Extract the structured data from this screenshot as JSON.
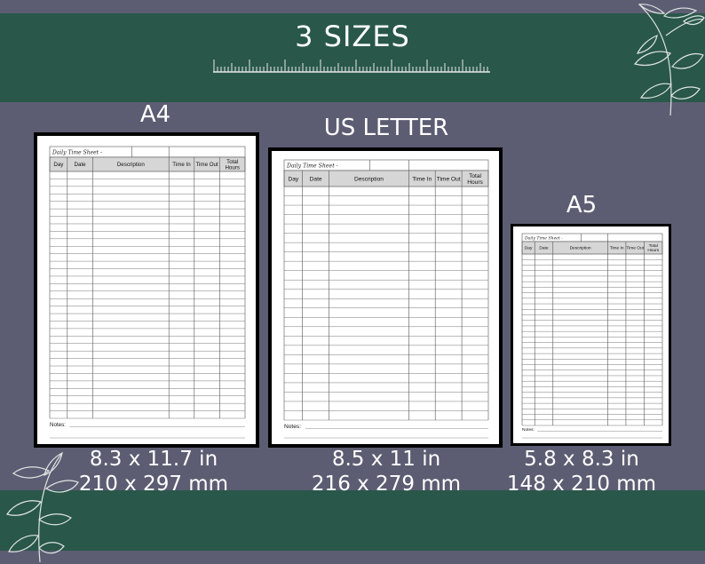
{
  "heading": "3 SIZES",
  "sheet_template": {
    "title": "Daily Time Sheet -",
    "columns": [
      "Day",
      "Date",
      "Description",
      "Time In",
      "Time Out",
      "Total Hours"
    ],
    "notes_label": "Notes:"
  },
  "sizes": [
    {
      "name": "A4",
      "inches": "8.3 x 11.7 in",
      "mm": "210 x 297 mm"
    },
    {
      "name": "US LETTER",
      "inches": "8.5 x 11 in",
      "mm": "216 x 279 mm"
    },
    {
      "name": "A5",
      "inches": "5.8 x 8.3 in",
      "mm": "148 x 210 mm"
    }
  ],
  "colors": {
    "background": "#5c5d72",
    "band": "#29574a",
    "text": "#ffffff",
    "table_header": "#d6d6d6"
  }
}
